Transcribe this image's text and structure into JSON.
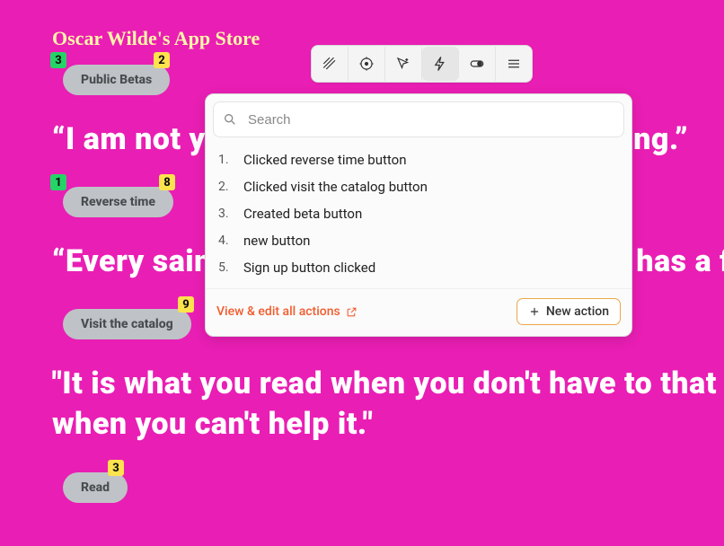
{
  "title": "Oscar Wilde's App Store",
  "buttons": {
    "public_betas": "Public Betas",
    "reverse_time": "Reverse time",
    "visit_catalog": "Visit the catalog",
    "read": "Read"
  },
  "quotes": {
    "q1": "“I am not young enough to know everything.”",
    "q2": "“Every saint has a past, and every sinner has a future.”",
    "q3": "\"It is what you read when you don't have to that determines",
    "q3b": "when you can't help it.\""
  },
  "badges": {
    "pb_left": "3",
    "pb_right": "2",
    "rt_left": "1",
    "rt_right": "8",
    "vc_right": "9",
    "read_right": "3"
  },
  "panel": {
    "search_placeholder": "Search",
    "items": [
      {
        "n": "1.",
        "label": "Clicked reverse time button"
      },
      {
        "n": "2.",
        "label": "Clicked visit the catalog button"
      },
      {
        "n": "3.",
        "label": "Created beta button"
      },
      {
        "n": "4.",
        "label": "new button"
      },
      {
        "n": "5.",
        "label": "Sign up button clicked"
      }
    ],
    "view_all": "View & edit all actions",
    "new_action": "New action"
  }
}
